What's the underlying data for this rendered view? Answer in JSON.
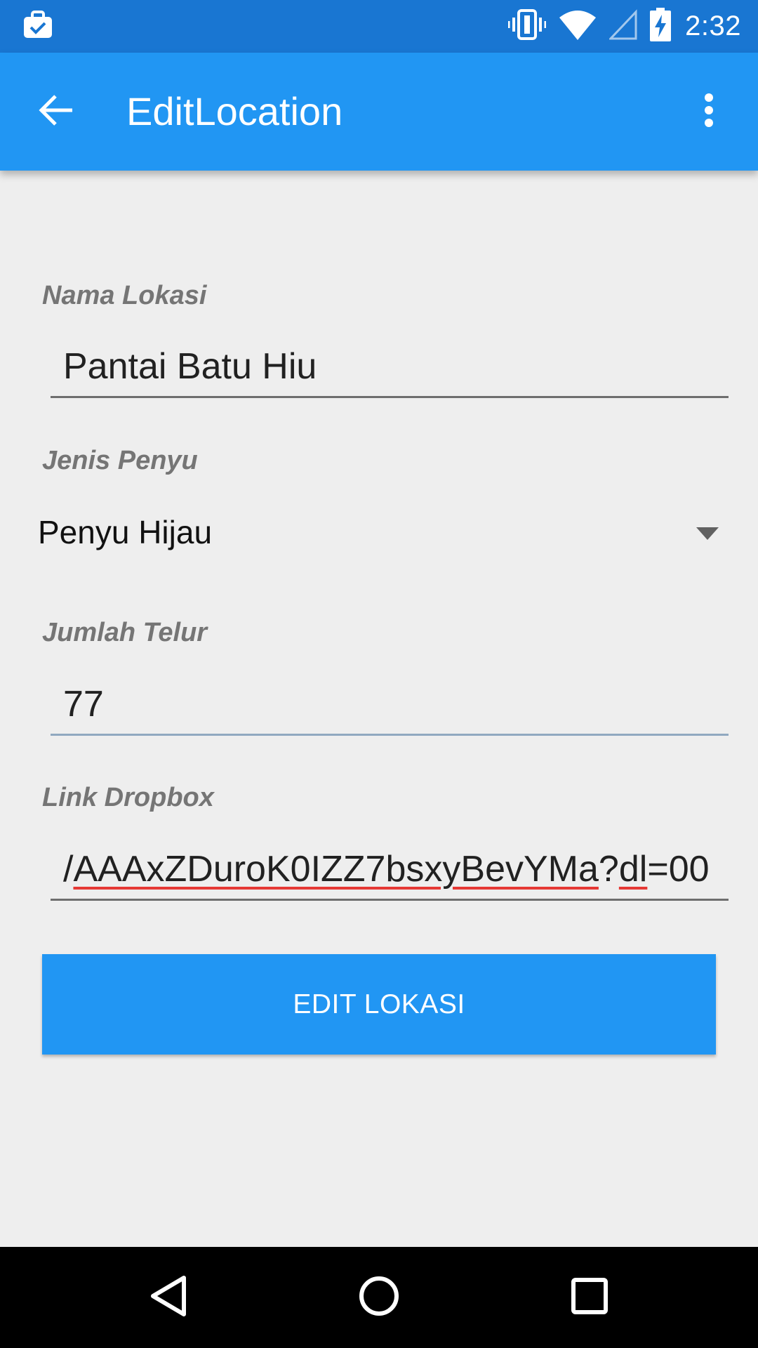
{
  "status_bar": {
    "time": "2:32",
    "icons": [
      "briefcase-check-icon",
      "vibrate-icon",
      "wifi-icon",
      "signal-icon",
      "battery-charging-icon"
    ],
    "color": "#1976d2"
  },
  "app_bar": {
    "title": "EditLocation",
    "back_icon": "arrow-back-icon",
    "overflow_icon": "more-vert-icon",
    "color": "#2196f3"
  },
  "form": {
    "nama_lokasi": {
      "label": "Nama Lokasi",
      "value": "Pantai Batu Hiu"
    },
    "jenis_penyu": {
      "label": "Jenis Penyu",
      "selected": "Penyu Hijau"
    },
    "jumlah_telur": {
      "label": "Jumlah Telur",
      "value": "77"
    },
    "link_dropbox": {
      "label": "Link Dropbox",
      "visible_value": "/AAAxZDuroK0IZZ7bsxyBevYMa?dl=00"
    },
    "submit_label": "EDIT LOKASI"
  },
  "nav_bar": {
    "icons": [
      "back-triangle-icon",
      "home-circle-icon",
      "recents-square-icon"
    ]
  }
}
